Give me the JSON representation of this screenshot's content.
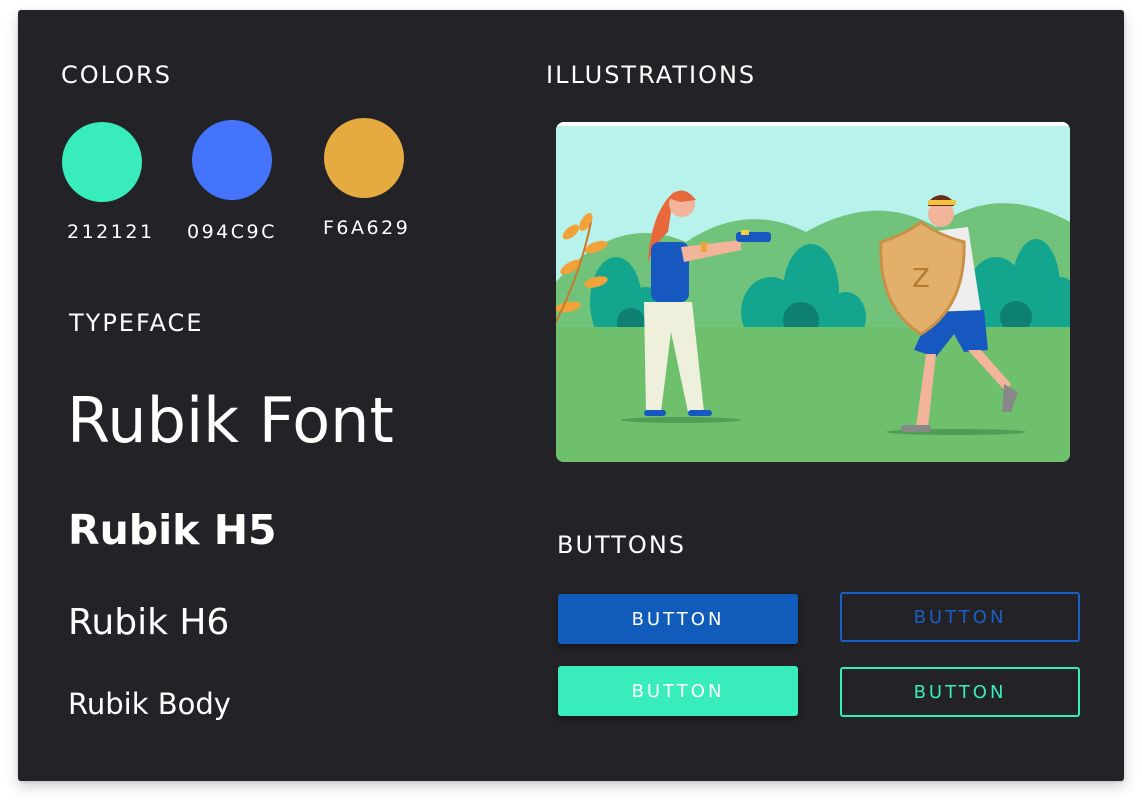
{
  "colors": {
    "title": "COLORS",
    "swatches": [
      {
        "label": "212121",
        "color": "#38ECBC"
      },
      {
        "label": "094C9C",
        "color": "#4474FC"
      },
      {
        "label": "F6A629",
        "color": "#E5AB40"
      }
    ]
  },
  "typeface": {
    "title": "TYPEFACE",
    "samples": [
      "Rubik Font",
      "Rubik H5",
      "Rubik H6",
      "Rubik Body"
    ]
  },
  "illustrations": {
    "title": "ILLUSTRATIONS"
  },
  "buttons": {
    "title": "BUTTONS",
    "items": [
      {
        "label": "BUTTON",
        "style": "filled",
        "color": "#115CBB"
      },
      {
        "label": "BUTTON",
        "style": "outline",
        "color": "#1A5FC4"
      },
      {
        "label": "BUTTON",
        "style": "filled",
        "color": "#38ECBC"
      },
      {
        "label": "BUTTON",
        "style": "outline",
        "color": "#38ECBC"
      }
    ]
  },
  "theme": {
    "background": "#232227",
    "text": "#FFFFFF"
  }
}
